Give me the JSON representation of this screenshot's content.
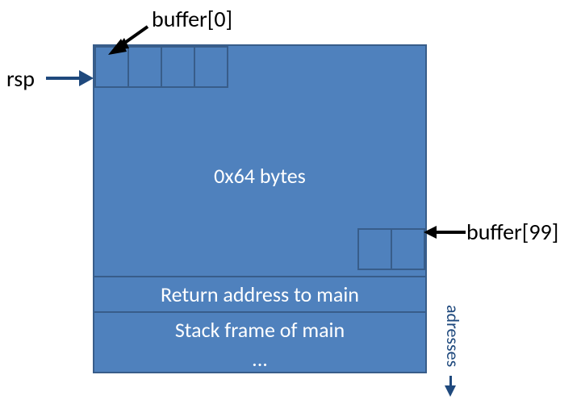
{
  "labels": {
    "rsp": "rsp",
    "buffer0": "buffer[0]",
    "buffer99": "buffer[99]",
    "bytes": "0x64 bytes",
    "return_addr": "Return address to main",
    "stack_frame": "Stack frame of main",
    "ellipsis": "...",
    "addresses": "adresses"
  }
}
